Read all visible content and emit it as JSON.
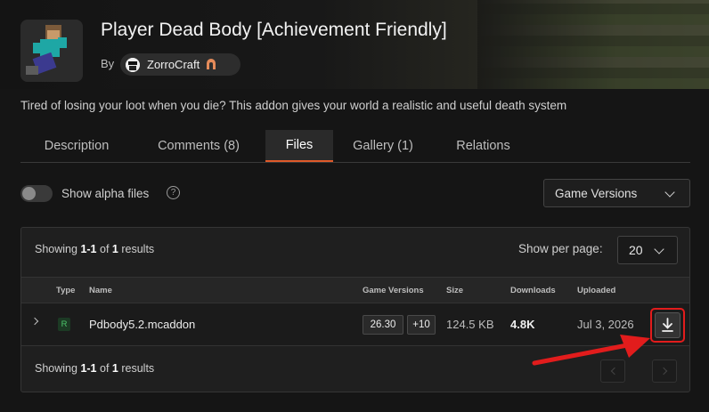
{
  "header": {
    "title": "Player Dead Body [Achievement Friendly]",
    "by_label": "By",
    "author": "ZorroCraft",
    "avatar_icon": "minecraft-character-icon",
    "author_badge_icon": "arch-badge-icon"
  },
  "description": "Tired of losing your loot when you die? This addon gives your world a realistic and useful death system",
  "tabs": [
    {
      "label": "Description",
      "active": false
    },
    {
      "label": "Comments (8)",
      "active": false
    },
    {
      "label": "Files",
      "active": true
    },
    {
      "label": "Gallery (1)",
      "active": false
    },
    {
      "label": "Relations",
      "active": false
    }
  ],
  "filters": {
    "alpha_label": "Show alpha files",
    "alpha_on": false,
    "help_symbol": "?",
    "game_versions_label": "Game Versions"
  },
  "results": {
    "showing_prefix": "Showing",
    "range": "1-1",
    "of": "of",
    "total": "1",
    "suffix": "results",
    "per_page_label": "Show per page:",
    "per_page": "20"
  },
  "table": {
    "columns": [
      "Type",
      "Name",
      "Game Versions",
      "Size",
      "Downloads",
      "Uploaded"
    ],
    "rows": [
      {
        "type": "R",
        "name": "Pdbody5.2.mcaddon",
        "version": "26.30",
        "extra_versions": "+10",
        "size": "124.5 KB",
        "downloads": "4.8K",
        "uploaded": "Jul 3, 2026"
      }
    ]
  },
  "colors": {
    "accent": "#e05a2a",
    "highlight": "#e21c1c",
    "release_badge": "#4cc46a"
  }
}
